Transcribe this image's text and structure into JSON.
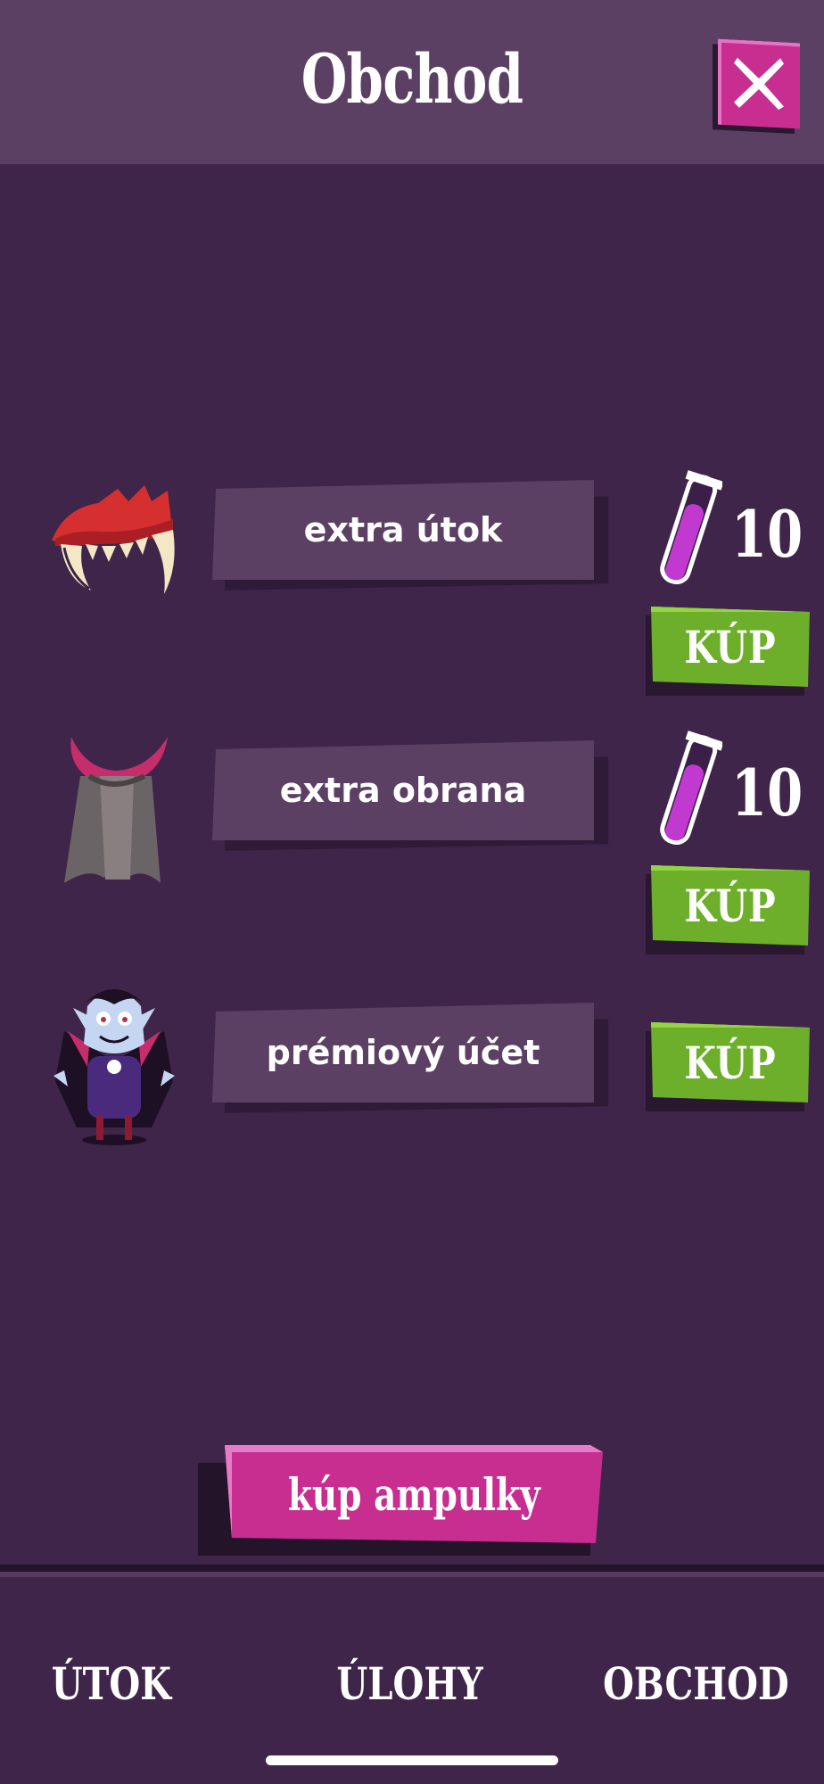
{
  "header": {
    "title": "Obchod",
    "close_icon": "close-x-icon"
  },
  "items": [
    {
      "icon": "fangs-icon",
      "label": "extra útok",
      "price": "10",
      "price_icon": "blood-vial-icon",
      "buy_label": "KÚP"
    },
    {
      "icon": "cape-icon",
      "label": "extra obrana",
      "price": "10",
      "price_icon": "blood-vial-icon",
      "buy_label": "KÚP"
    },
    {
      "icon": "vampire-character-icon",
      "label": "prémiový účet",
      "buy_label": "KÚP"
    }
  ],
  "buy_vials_label": "kúp ampulky",
  "nav": {
    "items": [
      "ÚTOK",
      "ÚLOHY",
      "OBCHOD"
    ]
  },
  "colors": {
    "background": "#3e2549",
    "header": "#5c4064",
    "plate": "#5c4064",
    "buy_green": "#6dae2a",
    "accent_pink": "#c72e8f"
  }
}
